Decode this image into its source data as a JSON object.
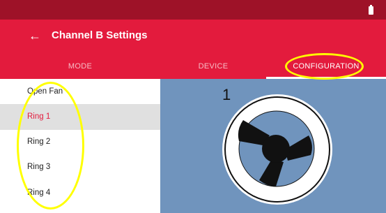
{
  "status_bar": {
    "battery_icon": "battery-icon"
  },
  "app_bar": {
    "back_icon": "arrow-back-icon",
    "title": "Channel B Settings"
  },
  "tabs": [
    {
      "label": "MODE",
      "selected": false
    },
    {
      "label": "DEVICE",
      "selected": false
    },
    {
      "label": "CONFIGURATION",
      "selected": true
    }
  ],
  "list": {
    "items": [
      {
        "label": "Open Fan",
        "selected": false
      },
      {
        "label": "Ring 1",
        "selected": true
      },
      {
        "label": "Ring 2",
        "selected": false
      },
      {
        "label": "Ring 3",
        "selected": false
      },
      {
        "label": "Ring 4",
        "selected": false
      }
    ]
  },
  "preview": {
    "number": "1",
    "icon": "fan-ring-icon"
  },
  "colors": {
    "status_bar": "#9e1228",
    "accent": "#e31b3d",
    "preview_background": "#7094bd",
    "highlight": "#ffff00"
  }
}
